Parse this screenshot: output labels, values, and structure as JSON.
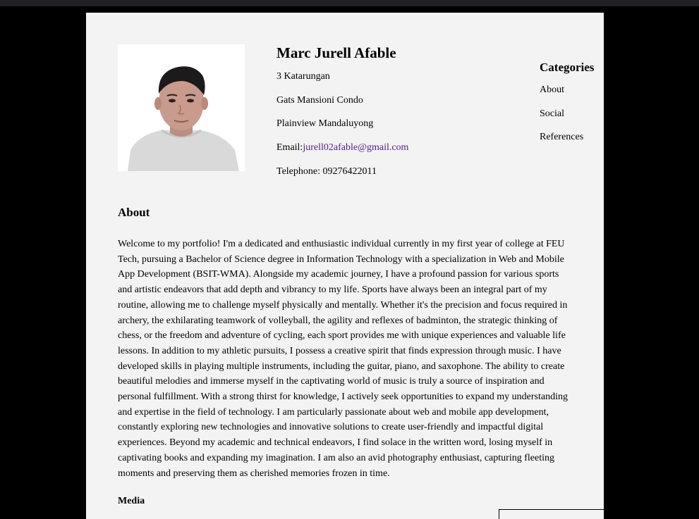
{
  "profile": {
    "name": "Marc Jurell Afable",
    "address_line1": "3 Katarungan",
    "address_line2": "Gats Mansioni Condo",
    "address_line3": "Plainview Mandaluyong",
    "email_label": "Email:",
    "email": "jurell02afable@gmail.com",
    "telephone": "Telephone: 09276422011"
  },
  "categories": {
    "heading": "Categories",
    "items": [
      {
        "label": "About"
      },
      {
        "label": "Social"
      },
      {
        "label": "References"
      }
    ]
  },
  "about": {
    "heading": "About",
    "text": "Welcome to my portfolio! I'm a dedicated and enthusiastic individual currently in my first year of college at FEU Tech, pursuing a Bachelor of Science degree in Information Technology with a specialization in Web and Mobile App Development (BSIT-WMA). Alongside my academic journey, I have a profound passion for various sports and artistic endeavors that add depth and vibrancy to my life. Sports have always been an integral part of my routine, allowing me to challenge myself physically and mentally. Whether it's the precision and focus required in archery, the exhilarating teamwork of volleyball, the agility and reflexes of badminton, the strategic thinking of chess, or the freedom and adventure of cycling, each sport provides me with unique experiences and valuable life lessons. In addition to my athletic pursuits, I possess a creative spirit that finds expression through music. I have developed skills in playing multiple instruments, including the guitar, piano, and saxophone. The ability to create beautiful melodies and immerse myself in the captivating world of music is truly a source of inspiration and personal fulfillment. With a strong thirst for knowledge, I actively seek opportunities to expand my understanding and expertise in the field of technology. I am particularly passionate about web and mobile app development, constantly exploring new technologies and innovative solutions to create user-friendly and impactful digital experiences. Beyond my academic and technical endeavors, I find solace in the written word, losing myself in captivating books and expanding my imagination. I am also an avid photography enthusiast, capturing fleeting moments and preserving them as cherished memories frozen in time."
  },
  "media": {
    "heading": "Media"
  },
  "colors": {
    "page_background": "#f3f3f3",
    "outer_background": "#000000",
    "link_visited": "#551a8b"
  }
}
